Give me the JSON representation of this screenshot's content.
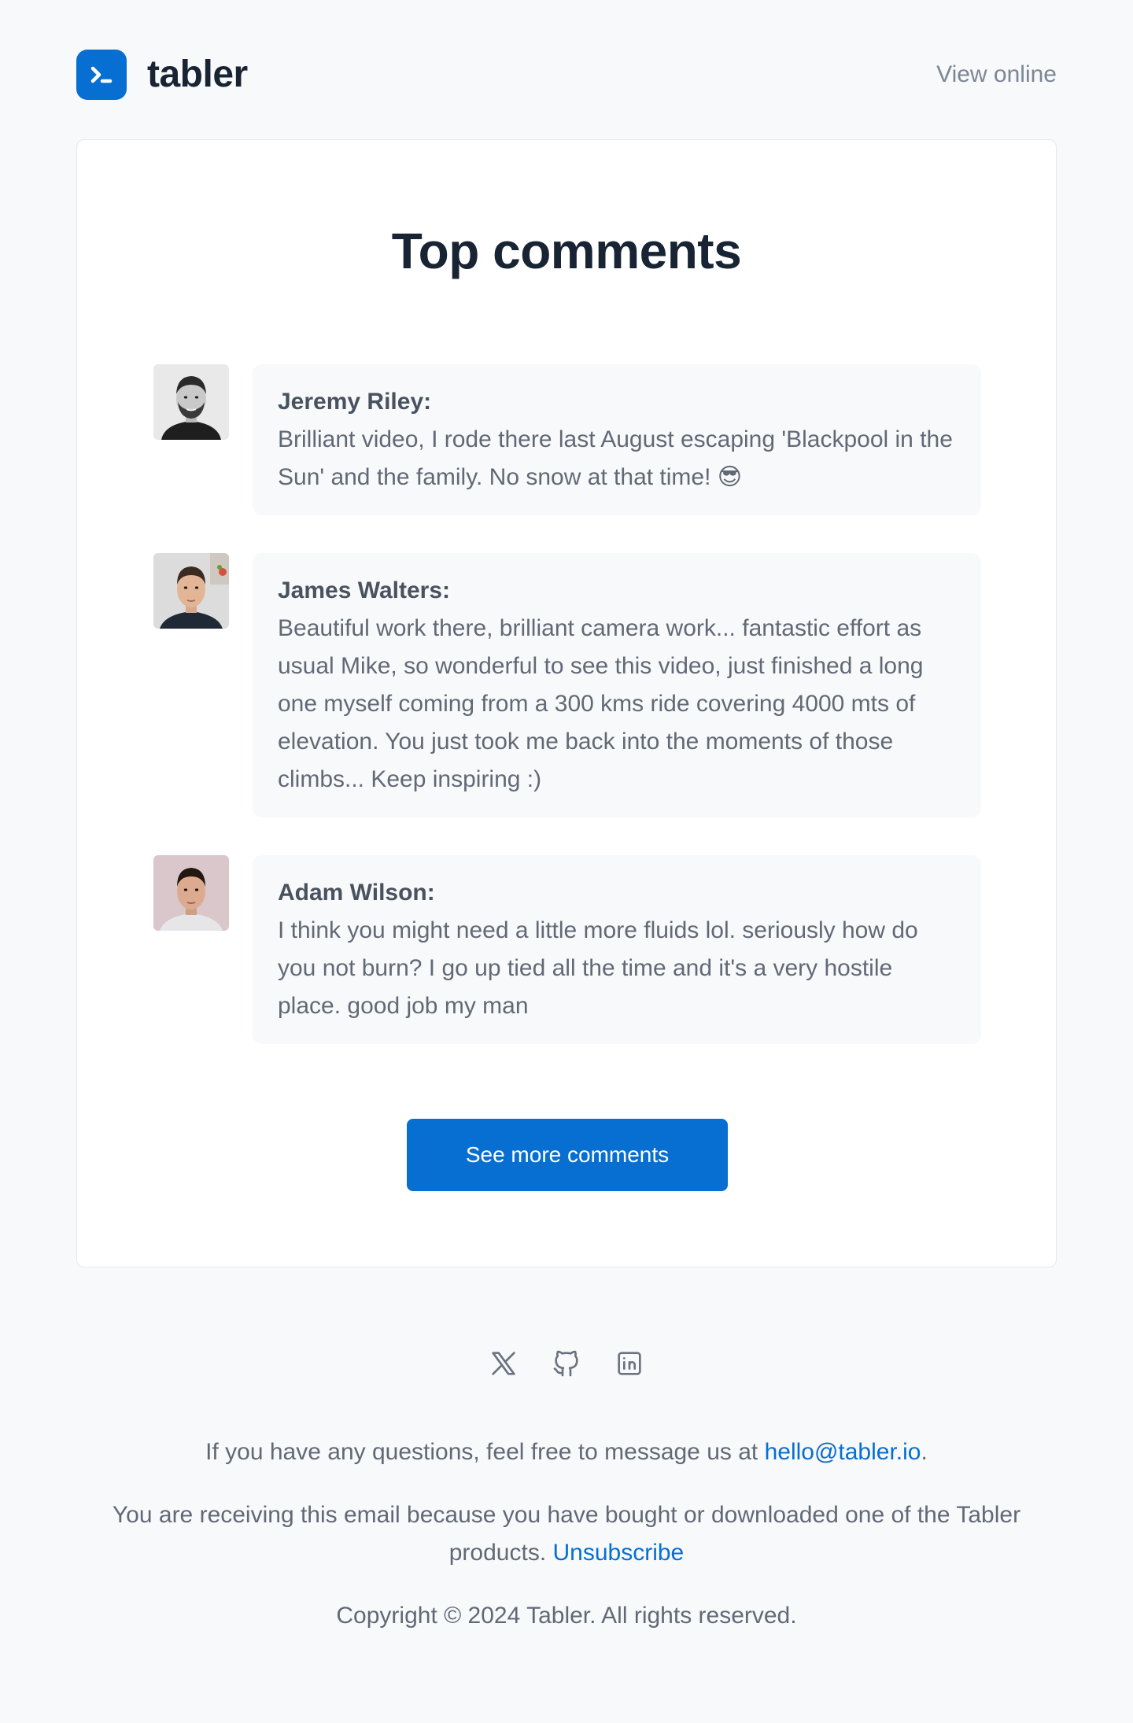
{
  "header": {
    "brand_name": "tabler",
    "view_online_label": "View online"
  },
  "card": {
    "title": "Top comments",
    "comments": [
      {
        "author": "Jeremy Riley:",
        "text": "Brilliant video, I rode there last August escaping 'Blackpool in the Sun' and the family. No snow at that time! 😎"
      },
      {
        "author": "James Walters:",
        "text": "Beautiful work there, brilliant camera work... fantastic effort as usual Mike, so wonderful to see this video, just finished a long one myself coming from a 300 kms ride covering 4000 mts of elevation. You just took me back into the moments of those climbs... Keep inspiring :)"
      },
      {
        "author": "Adam Wilson:",
        "text": "I think you might need a little more fluids lol. seriously how do you not burn? I go up tied all the time and it's a very hostile place. good job my man"
      }
    ],
    "cta_label": "See more comments"
  },
  "footer": {
    "social_icons": [
      "x-icon",
      "github-icon",
      "linkedin-icon"
    ],
    "questions_prefix": "If you have any questions, feel free to message us at ",
    "email": "hello@tabler.io",
    "questions_suffix": ".",
    "receiving_text": "You are receiving this email because you have bought or downloaded one of the Tabler products. ",
    "unsubscribe_label": "Unsubscribe",
    "copyright": "Copyright © 2024 Tabler. All rights reserved."
  },
  "colors": {
    "accent": "#066fd1",
    "background": "#f8f9fb",
    "bubble": "#f8f9fa"
  }
}
